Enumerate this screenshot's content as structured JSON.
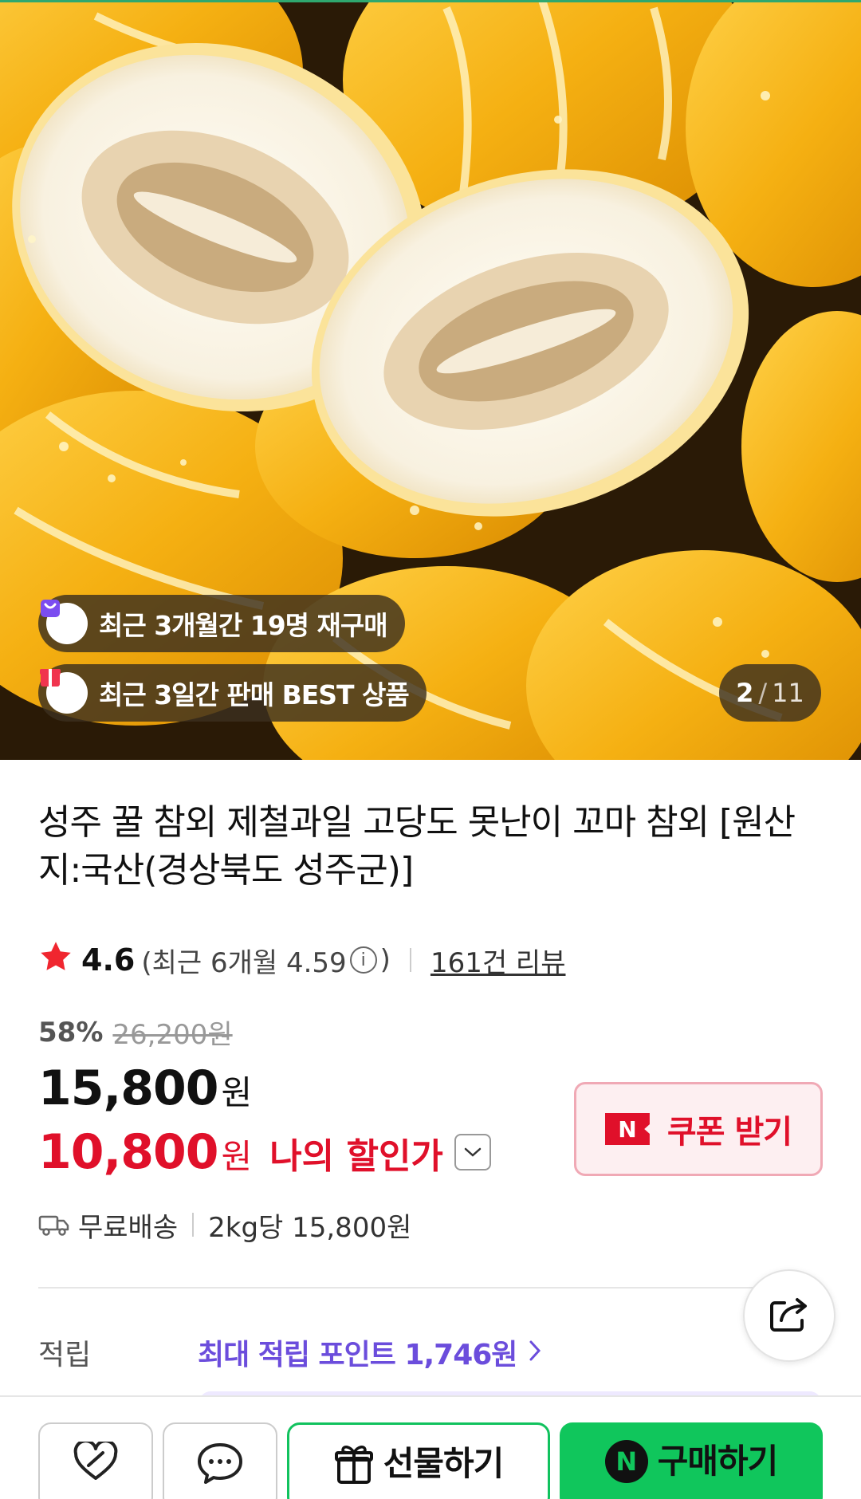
{
  "hero": {
    "badges": [
      {
        "icon": "shopping-bag-icon",
        "text": "최근 3개월간 19명 재구매"
      },
      {
        "icon": "gift-box-icon",
        "text": "최근 3일간 판매 BEST 상품"
      }
    ],
    "pager": {
      "current": "2",
      "separator": "/",
      "total": "11"
    }
  },
  "product": {
    "title": "성주 꿀 참외 제철과일 고당도 못난이 꼬마 참외 [원산지:국산(경상북도 성주군)]",
    "rating": {
      "score": "4.6",
      "recent_prefix": "(최근 6개월 4.59",
      "recent_suffix": ")",
      "reviews": "161건 리뷰"
    },
    "discount_percent": "58%",
    "original_price": "26,200원",
    "price": {
      "number": "15,800",
      "unit": "원"
    },
    "my_price": {
      "number": "10,800",
      "unit": "원",
      "label": "나의 할인가"
    },
    "coupon": {
      "logo": "N",
      "label": "쿠폰 받기"
    },
    "shipping": {
      "free": "무료배송",
      "unit_price": "2kg당 15,800원"
    },
    "points": {
      "label": "적립",
      "value": "최대 적립 포인트 1,746원"
    }
  },
  "bottom_bar": {
    "gift_label": "선물하기",
    "buy_logo": "N",
    "buy_label": "구매하기"
  },
  "colors": {
    "accent_red": "#e0102a",
    "points_purple": "#6b4ddc",
    "buy_green": "#10c65c",
    "melon_yellow": "#f4b400"
  }
}
